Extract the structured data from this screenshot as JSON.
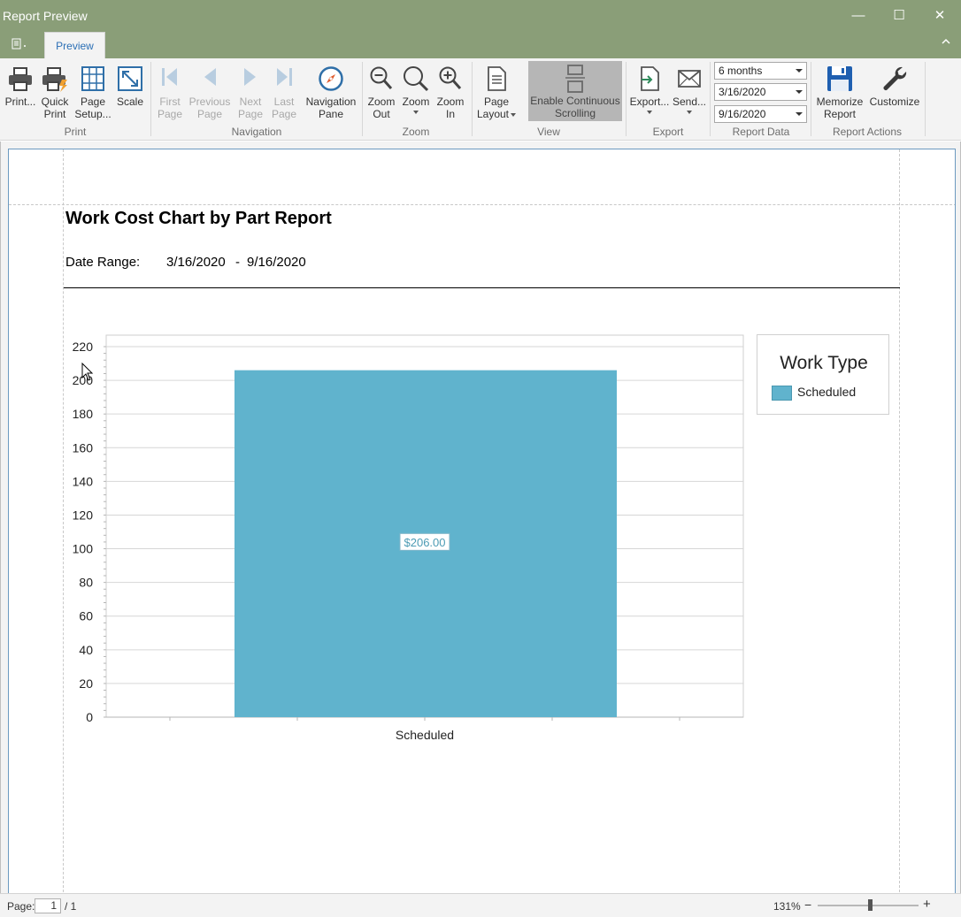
{
  "window": {
    "title": "Report Preview",
    "controls": {
      "minimize": "—",
      "maximize": "☐",
      "close": "✕"
    }
  },
  "tabs": {
    "preview": "Preview"
  },
  "ribbon": {
    "print": {
      "print": "Print...",
      "quick_print_1": "Quick",
      "quick_print_2": "Print",
      "page_setup_1": "Page",
      "page_setup_2": "Setup...",
      "scale": "Scale",
      "group": "Print"
    },
    "navigation": {
      "first_1": "First",
      "first_2": "Page",
      "prev_1": "Previous",
      "prev_2": "Page",
      "next_1": "Next",
      "next_2": "Page",
      "last_1": "Last",
      "last_2": "Page",
      "nav_pane_1": "Navigation",
      "nav_pane_2": "Pane",
      "group": "Navigation"
    },
    "zoom": {
      "zoom_out_1": "Zoom",
      "zoom_out_2": "Out",
      "zoom": "Zoom",
      "zoom_in_1": "Zoom",
      "zoom_in_2": "In",
      "group": "Zoom"
    },
    "view": {
      "page_layout_1": "Page",
      "page_layout_2": "Layout",
      "continuous_1": "Enable Continuous",
      "continuous_2": "Scrolling",
      "group": "View"
    },
    "export": {
      "export": "Export...",
      "send": "Send...",
      "group": "Export"
    },
    "report_data": {
      "period": "6 months",
      "start": "3/16/2020",
      "end": "9/16/2020",
      "group": "Report Data"
    },
    "report_actions": {
      "memorize_1": "Memorize",
      "memorize_2": "Report",
      "customize": "Customize",
      "group": "Report Actions"
    }
  },
  "report": {
    "title": "Work Cost Chart by Part Report",
    "date_range_label": "Date Range:",
    "date_start": "3/16/2020",
    "date_sep": "-",
    "date_end": "9/16/2020"
  },
  "colors": {
    "bar": "#60b3cd",
    "title_bar": "#8a9e78"
  },
  "chart_data": {
    "type": "bar",
    "categories": [
      "Scheduled"
    ],
    "series": [
      {
        "name": "Scheduled",
        "values": [
          206
        ]
      }
    ],
    "data_labels": [
      "$206.00"
    ],
    "ylim": [
      0,
      220
    ],
    "yticks": [
      0,
      20,
      40,
      60,
      80,
      100,
      120,
      140,
      160,
      180,
      200,
      220
    ],
    "grid": true,
    "legend": {
      "title": "Work Type",
      "position": "right"
    }
  },
  "status": {
    "page_label": "Page:",
    "page_current": "1",
    "page_total": "/ 1",
    "zoom_percent": "131%",
    "zoom_minus": "−",
    "zoom_plus": "+",
    "zoom_level": 0.52
  }
}
